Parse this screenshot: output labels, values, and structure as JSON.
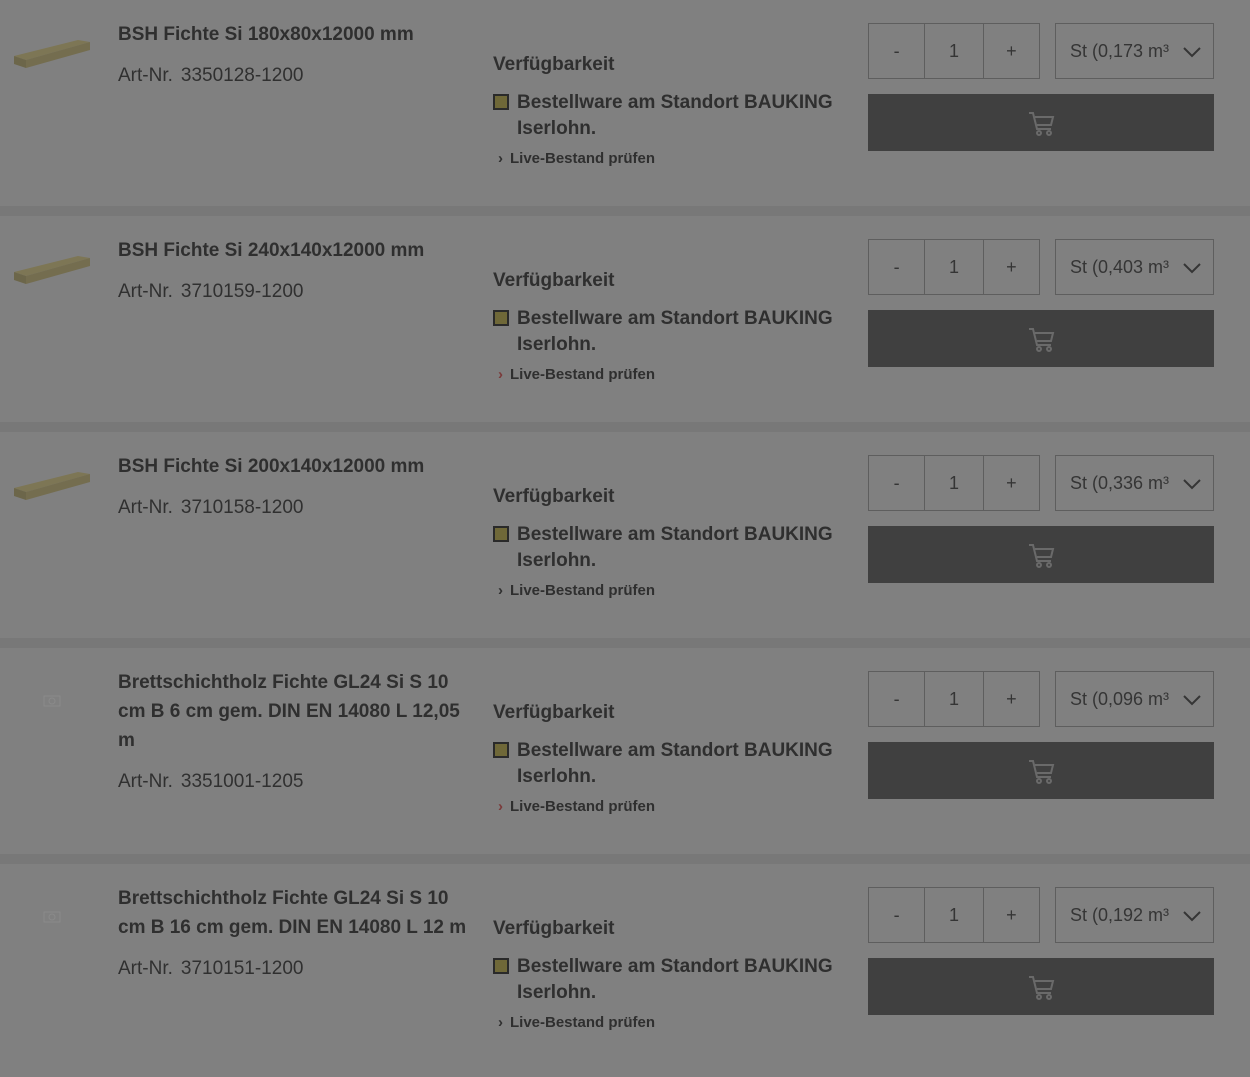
{
  "labels": {
    "availability_heading": "Verfügbarkeit",
    "artnr_label": "Art-Nr.",
    "live_check": "Live-Bestand prüfen",
    "qty_minus": "-",
    "qty_plus": "+"
  },
  "products": [
    {
      "title": "BSH Fichte Si 180x80x12000 mm",
      "artnr": "3350128-1200",
      "stock": "Bestellware am Standort BAUKING Iserlohn.",
      "qty": "1",
      "unit": "St (0,173 m³",
      "thumb": "timber-beam-image"
    },
    {
      "title": "BSH Fichte Si 240x140x12000 mm",
      "artnr": "3710159-1200",
      "stock": "Bestellware am Standort BAUKING Iserlohn.",
      "qty": "1",
      "unit": "St (0,403 m³",
      "thumb": "timber-beam-image"
    },
    {
      "title": "BSH Fichte Si 200x140x12000 mm",
      "artnr": "3710158-1200",
      "stock": "Bestellware am Standort BAUKING Iserlohn.",
      "qty": "1",
      "unit": "St (0,336 m³",
      "thumb": "timber-beam-image"
    },
    {
      "title": "Brettschichtholz Fichte GL24 Si S 10 cm B 6 cm gem. DIN EN 14080 L 12,05 m",
      "artnr": "3351001-1205",
      "stock": "Bestellware am Standort BAUKING Iserlohn.",
      "qty": "1",
      "unit": "St (0,096 m³",
      "thumb": "placeholder-image"
    },
    {
      "title": "Brettschichtholz Fichte GL24 Si S 10 cm B 16 cm gem. DIN EN 14080 L 12 m",
      "artnr": "3710151-1200",
      "stock": "Bestellware am Standort BAUKING Iserlohn.",
      "qty": "1",
      "unit": "St (0,192 m³",
      "thumb": "placeholder-image"
    }
  ],
  "colors": {
    "overlay_background": "#808080",
    "cart_button": "#404040",
    "stock_indicator": "#6f6838"
  }
}
